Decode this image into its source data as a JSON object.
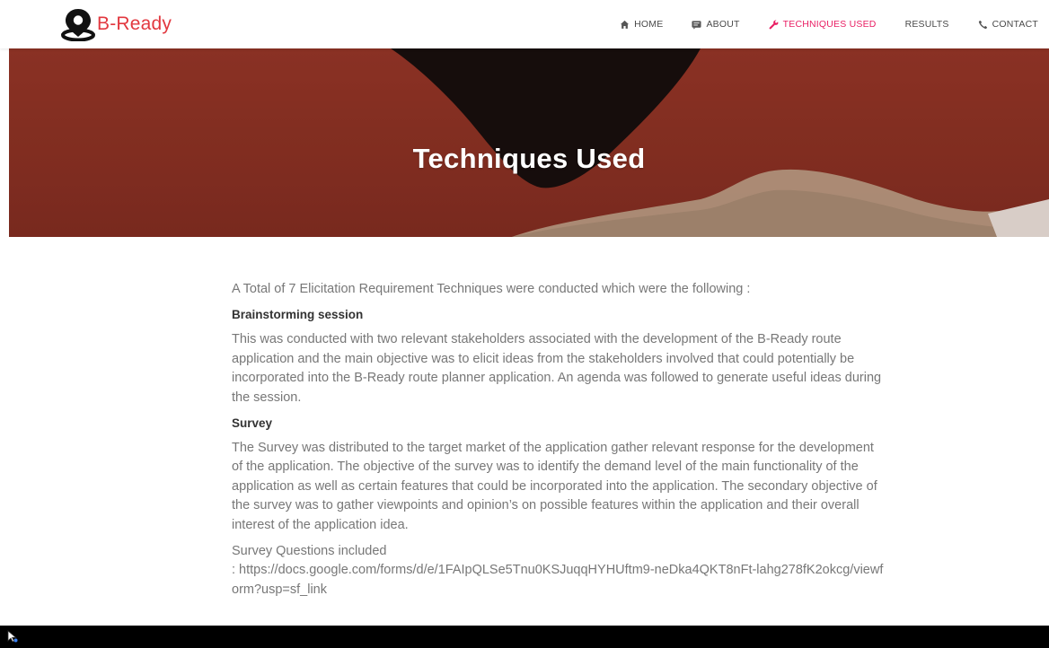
{
  "brand": {
    "name": "B-Ready",
    "color": "#e2383f"
  },
  "nav": {
    "items": [
      {
        "label": "HOME",
        "icon": "home-icon",
        "active": false
      },
      {
        "label": "ABOUT",
        "icon": "about-icon",
        "active": false
      },
      {
        "label": "TECHNIQUES USED",
        "icon": "wrench-icon",
        "active": true
      },
      {
        "label": "RESULTS",
        "icon": "",
        "active": false
      },
      {
        "label": "CONTACT",
        "icon": "phone-icon",
        "active": false
      }
    ],
    "active_color": "#e91e63"
  },
  "hero": {
    "title": "Techniques Used",
    "background": "#7e2d20"
  },
  "content": {
    "intro": "A Total of 7 Elicitation Requirement Techniques were conducted which were the following :",
    "sections": [
      {
        "heading": "Brainstorming session",
        "body": "This was conducted with two relevant stakeholders associated with the development of the B-Ready route application and the main objective was to elicit ideas from the stakeholders involved that could potentially be incorporated into the B-Ready route planner application. An agenda was followed to generate useful ideas during the session."
      },
      {
        "heading": "Survey",
        "body": "The Survey was distributed to the target market of the application gather relevant response for the development of the application. The objective of the survey was to identify the demand level of the main functionality of the application as well as certain features that could be incorporated into the application. The secondary objective of the survey was to gather viewpoints and opinion’s on possible features within the application and their overall interest of the application idea."
      }
    ],
    "survey_questions_label": "Survey Questions included",
    "survey_link": ": https://docs.google.com/forms/d/e/1FAIpQLSe5Tnu0KSJuqqHYHUftm9-neDka4QKT8nFt-lahg278fK2okcg/viewform?usp=sf_link"
  },
  "footer": {
    "cursor_icon": "cursor-icon"
  }
}
